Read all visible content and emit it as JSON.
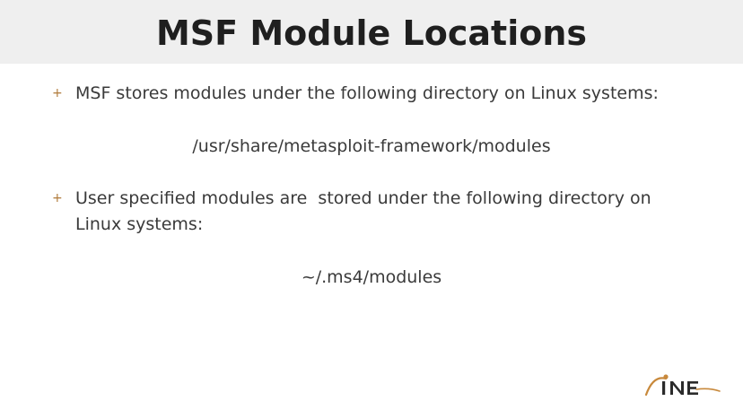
{
  "slide": {
    "title": "MSF Module Locations",
    "bullets": [
      {
        "marker": "+",
        "text": "MSF stores modules under the following directory on Linux systems:",
        "path": "/usr/share/metasploit-framework/modules"
      },
      {
        "marker": "+",
        "text": "User specified modules are  stored under the following directory on Linux systems:",
        "path": "~/.ms4/modules"
      }
    ]
  },
  "logo": {
    "text": "INE",
    "accent_color": "#c8893c",
    "text_color": "#2b2b2b"
  }
}
